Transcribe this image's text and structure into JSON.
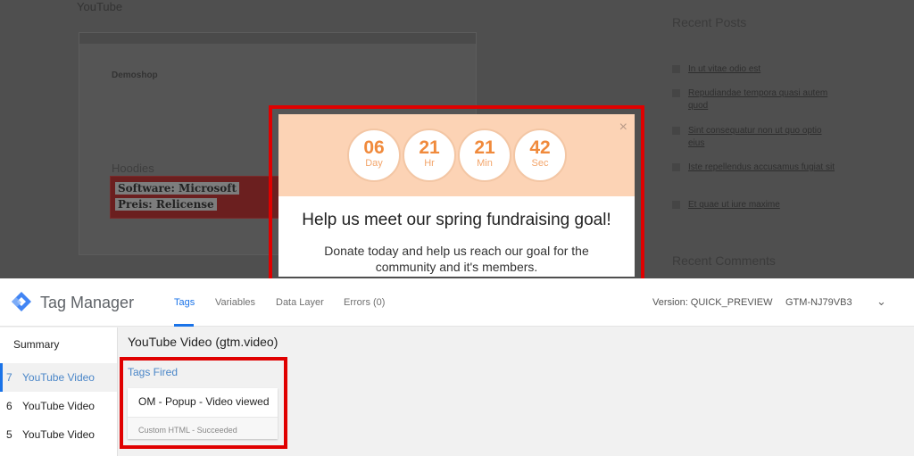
{
  "background_page": {
    "heading": "YouTube",
    "embedded_screenshot": {
      "site_title": "Demoshop",
      "category": "Hoodies",
      "banner_line1": "Software: Microsoft",
      "banner_line2": "Preis: Relicense"
    },
    "sidebar": {
      "recent_posts_title": "Recent Posts",
      "posts": [
        "In ut vitae odio est",
        "Repudiandae tempora quasi autem quod",
        "Sint consequatur non ut quo optio eius",
        "Iste repellendus accusamus fugiat sit",
        "Et quae ut iure maxime"
      ],
      "recent_comments_title": "Recent Comments"
    }
  },
  "popup": {
    "countdown": [
      {
        "value": "06",
        "unit": "Day"
      },
      {
        "value": "21",
        "unit": "Hr"
      },
      {
        "value": "21",
        "unit": "Min"
      },
      {
        "value": "42",
        "unit": "Sec"
      }
    ],
    "close_icon": "×",
    "headline": "Help us meet our spring fundraising goal!",
    "body": "Donate today and help us reach our goal for the community and it's members.",
    "colors": {
      "top": "#fcd3b5",
      "accent": "#f08a3c",
      "highlight": "#e00000"
    }
  },
  "tag_manager": {
    "brand": "Tag Manager",
    "tabs": [
      {
        "label": "Tags",
        "active": true
      },
      {
        "label": "Variables"
      },
      {
        "label": "Data Layer"
      },
      {
        "label": "Errors (0)"
      }
    ],
    "version": "Version: QUICK_PREVIEW",
    "container_id": "GTM-NJ79VB3",
    "sidebar": {
      "summary": "Summary",
      "events": [
        {
          "num": "7",
          "label": "YouTube Video",
          "selected": true
        },
        {
          "num": "6",
          "label": "YouTube Video"
        },
        {
          "num": "5",
          "label": "YouTube Video"
        }
      ]
    },
    "event_title": "YouTube Video (gtm.video)",
    "tags_fired_label": "Tags Fired",
    "fired_tag": {
      "name": "OM - Popup - Video viewed",
      "status": "Custom HTML - Succeeded"
    }
  }
}
